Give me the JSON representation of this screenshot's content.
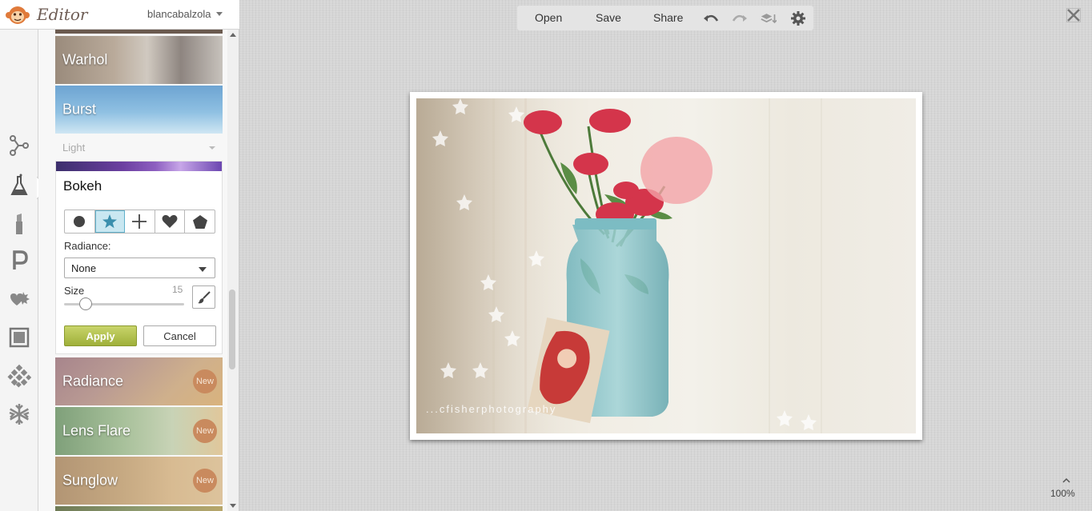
{
  "app": {
    "title": "Editor",
    "user": "blancabalzola"
  },
  "toolbar": {
    "open": "Open",
    "save": "Save",
    "share": "Share"
  },
  "effects": {
    "warhol": "Warhol",
    "burst": "Burst",
    "section": "Light",
    "bokeh": {
      "title": "Bokeh",
      "shapes": [
        "circle",
        "star",
        "cross",
        "heart",
        "pentagon"
      ],
      "selected_shape": "star",
      "radiance_label": "Radiance:",
      "radiance_value": "None",
      "size_label": "Size",
      "size_value": "15",
      "apply": "Apply",
      "cancel": "Cancel"
    },
    "radiance": "Radiance",
    "lens_flare": "Lens Flare",
    "sunglow": "Sunglow",
    "new_badge": "New"
  },
  "canvas": {
    "zoom": "100%",
    "watermark": "...cfisherphotography"
  },
  "colors": {
    "accent_green": "#9fb03a",
    "selected_shape_bg": "#c9e7f1",
    "new_badge": "#c98a5e"
  }
}
